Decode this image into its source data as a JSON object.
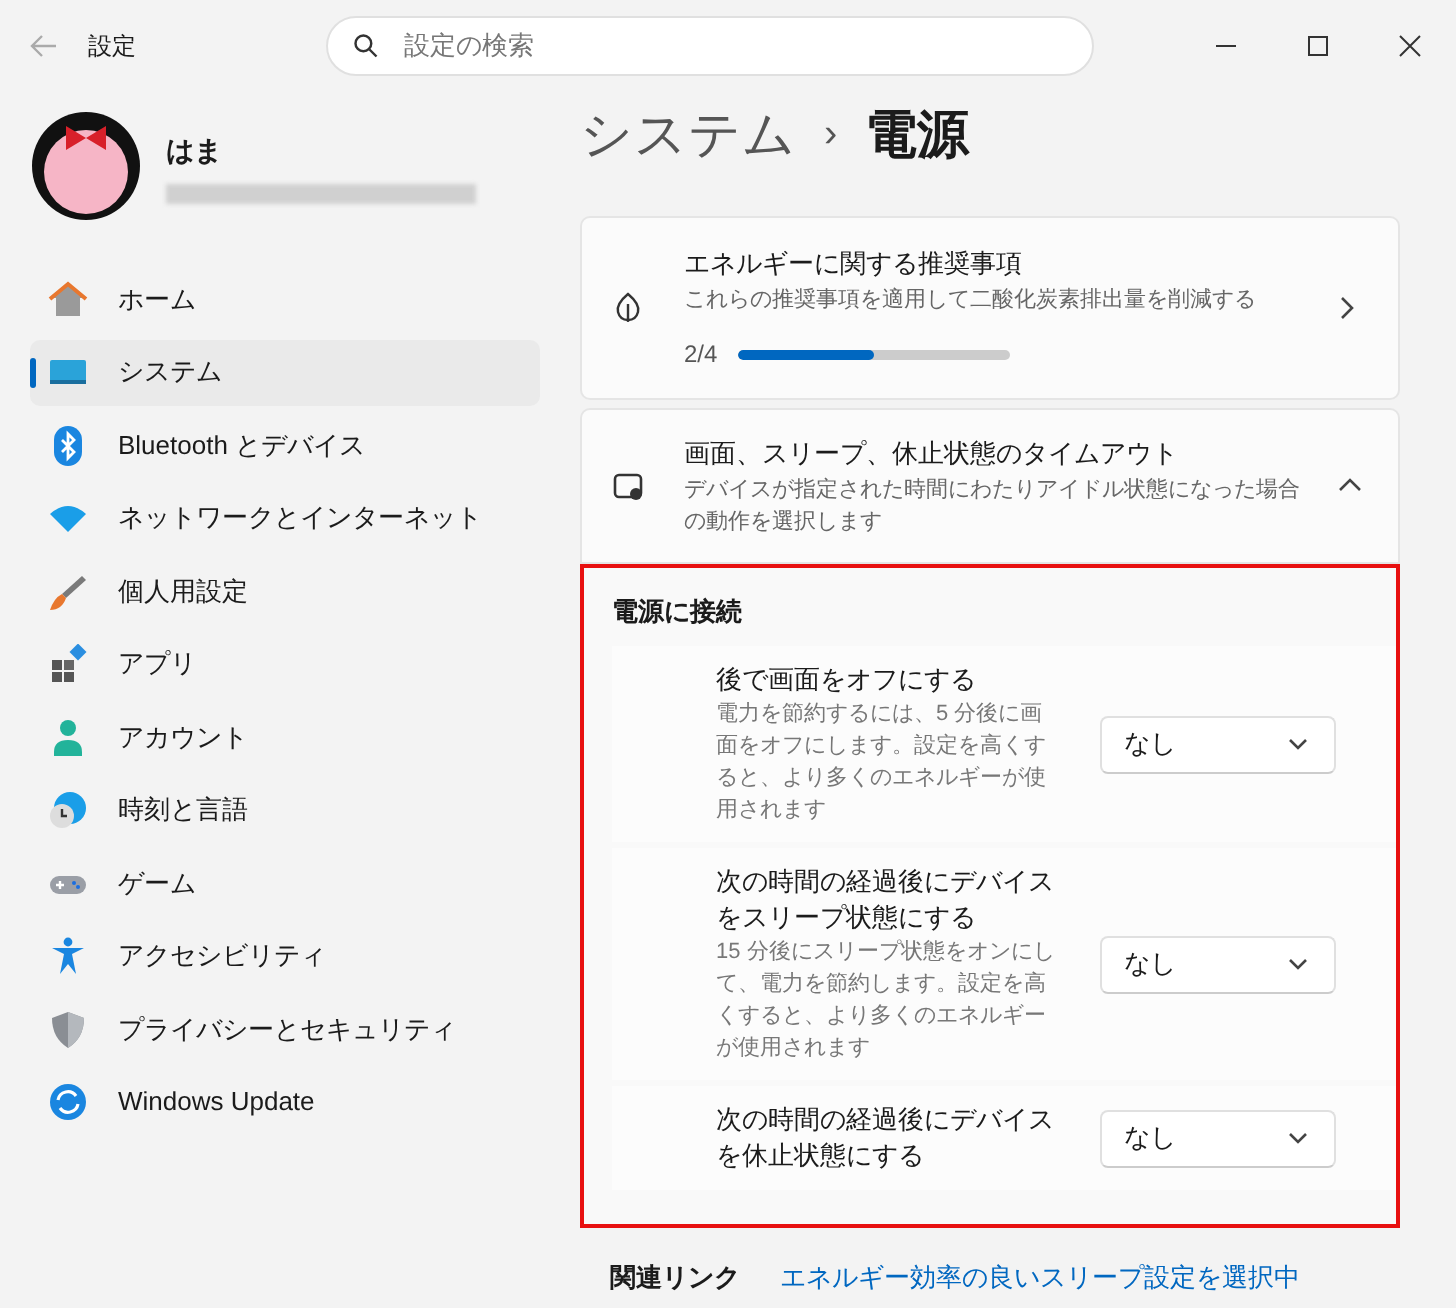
{
  "window": {
    "title": "設定"
  },
  "search": {
    "placeholder": "設定の検索"
  },
  "profile": {
    "name": "はま"
  },
  "sidebar": {
    "items": [
      {
        "label": "ホーム",
        "selected": false
      },
      {
        "label": "システム",
        "selected": true
      },
      {
        "label": "Bluetooth とデバイス",
        "selected": false
      },
      {
        "label": "ネットワークとインターネット",
        "selected": false
      },
      {
        "label": "個人用設定",
        "selected": false
      },
      {
        "label": "アプリ",
        "selected": false
      },
      {
        "label": "アカウント",
        "selected": false
      },
      {
        "label": "時刻と言語",
        "selected": false
      },
      {
        "label": "ゲーム",
        "selected": false
      },
      {
        "label": "アクセシビリティ",
        "selected": false
      },
      {
        "label": "プライバシーとセキュリティ",
        "selected": false
      },
      {
        "label": "Windows Update",
        "selected": false
      }
    ]
  },
  "breadcrumb": {
    "parent": "システム",
    "separator": "›",
    "current": "電源"
  },
  "energy_card": {
    "title": "エネルギーに関する推奨事項",
    "description": "これらの推奨事項を適用して二酸化炭素排出量を削減する",
    "progress_text": "2/4",
    "level": 0.5
  },
  "timeout_card": {
    "title": "画面、スリープ、休止状態のタイムアウト",
    "description": "デバイスが指定された時間にわたりアイドル状態になった場合の動作を選択します",
    "expanded": true
  },
  "plugged_in": {
    "heading": "電源に接続",
    "rows": [
      {
        "title": "後で画面をオフにする",
        "description": "電力を節約するには、5 分後に画面をオフにします。設定を高くすると、より多くのエネルギーが使用されます",
        "value": "なし"
      },
      {
        "title": "次の時間の経過後にデバイスをスリープ状態にする",
        "description": "15 分後にスリープ状態をオンにして、電力を節約します。設定を高くすると、より多くのエネルギーが使用されます",
        "value": "なし"
      },
      {
        "title": "次の時間の経過後にデバイスを休止状態にする",
        "value": "なし"
      }
    ]
  },
  "related_links": {
    "label": "関連リンク",
    "link": "エネルギー効率の良いスリープ設定を選択中"
  }
}
